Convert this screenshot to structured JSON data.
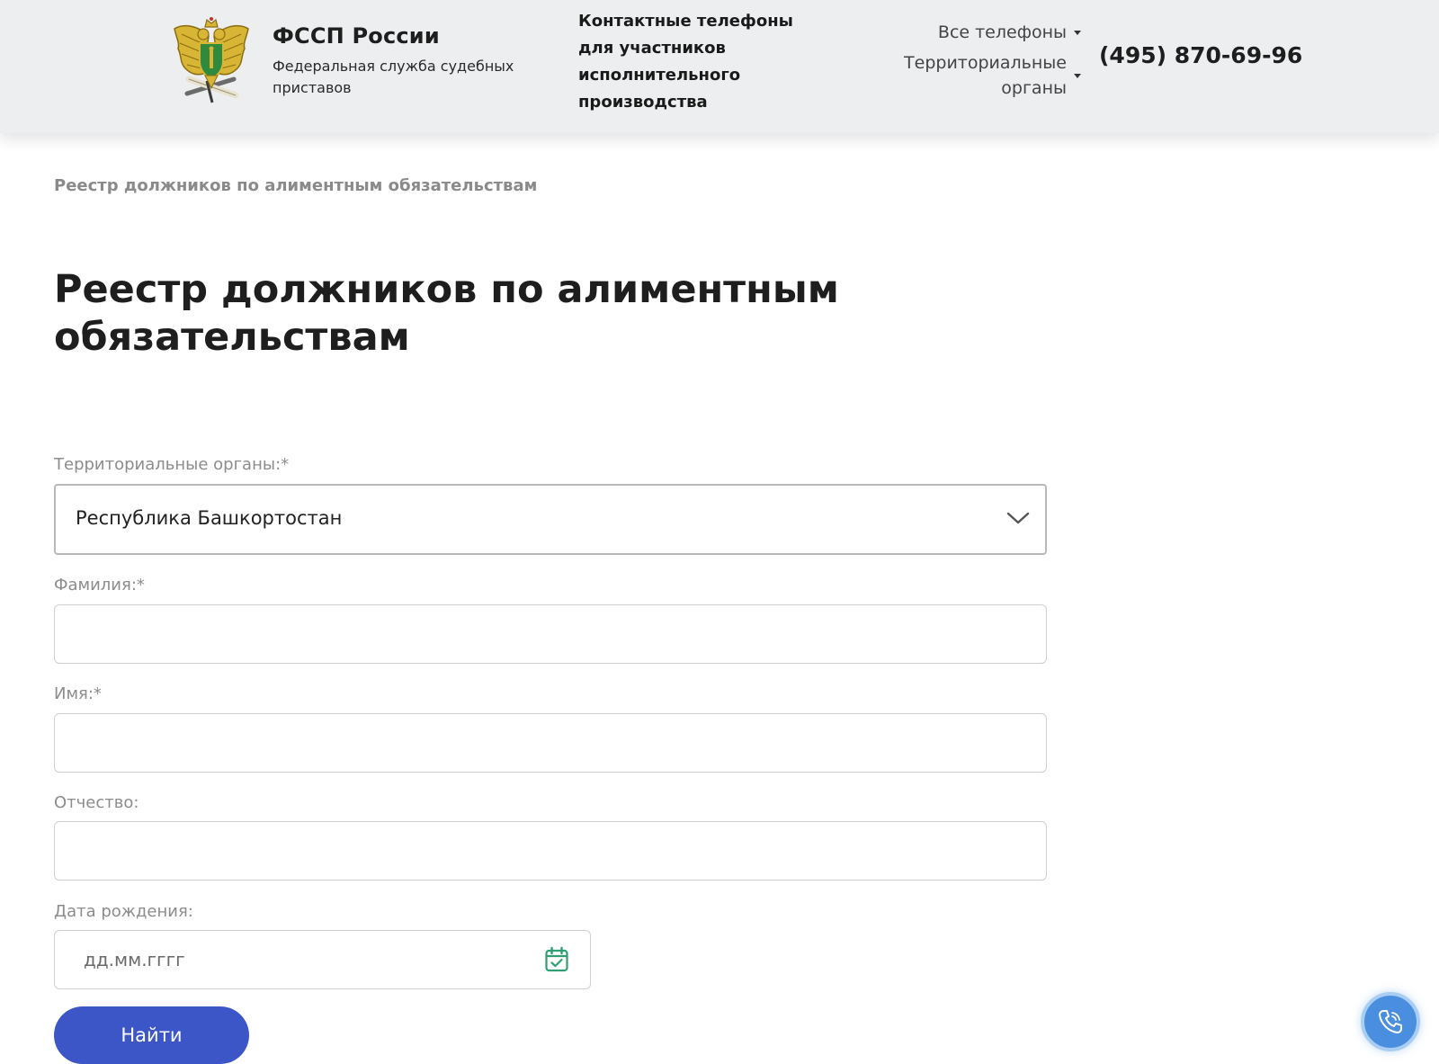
{
  "header": {
    "brand_title": "ФССП России",
    "brand_subtitle": "Федеральная служба судебных приставов",
    "contacts_heading": "Контактные телефоны для участников исполнительного производства",
    "menu_all_phones": "Все телефоны",
    "menu_territorial": "Территориальные органы",
    "phone": "(495) 870-69-96"
  },
  "breadcrumb": "Реестр должников по алиментным обязательствам",
  "page_title": "Реестр должников по алиментным обязательствам",
  "form": {
    "territorial_label": "Территориальные органы:*",
    "territorial_value": "Республика Башкортостан",
    "surname_label": "Фамилия:*",
    "surname_value": "",
    "name_label": "Имя:*",
    "name_value": "",
    "patronymic_label": "Отчество:",
    "patronymic_value": "",
    "birthdate_label": "Дата рождения:",
    "birthdate_placeholder": "дд.мм.гггг",
    "submit_label": "Найти"
  },
  "icons": {
    "logo": "fssp-emblem-logo",
    "select_arrow": "chevron-down-icon",
    "calendar": "calendar-icon",
    "call": "phone-icon"
  },
  "colors": {
    "header_bg": "#eceeef",
    "primary_button": "#3d56c7",
    "call_button": "#4a8fdf",
    "calendar_icon": "#2e9e73",
    "emblem_gold": "#d8b534",
    "emblem_green": "#2f8a3e"
  }
}
